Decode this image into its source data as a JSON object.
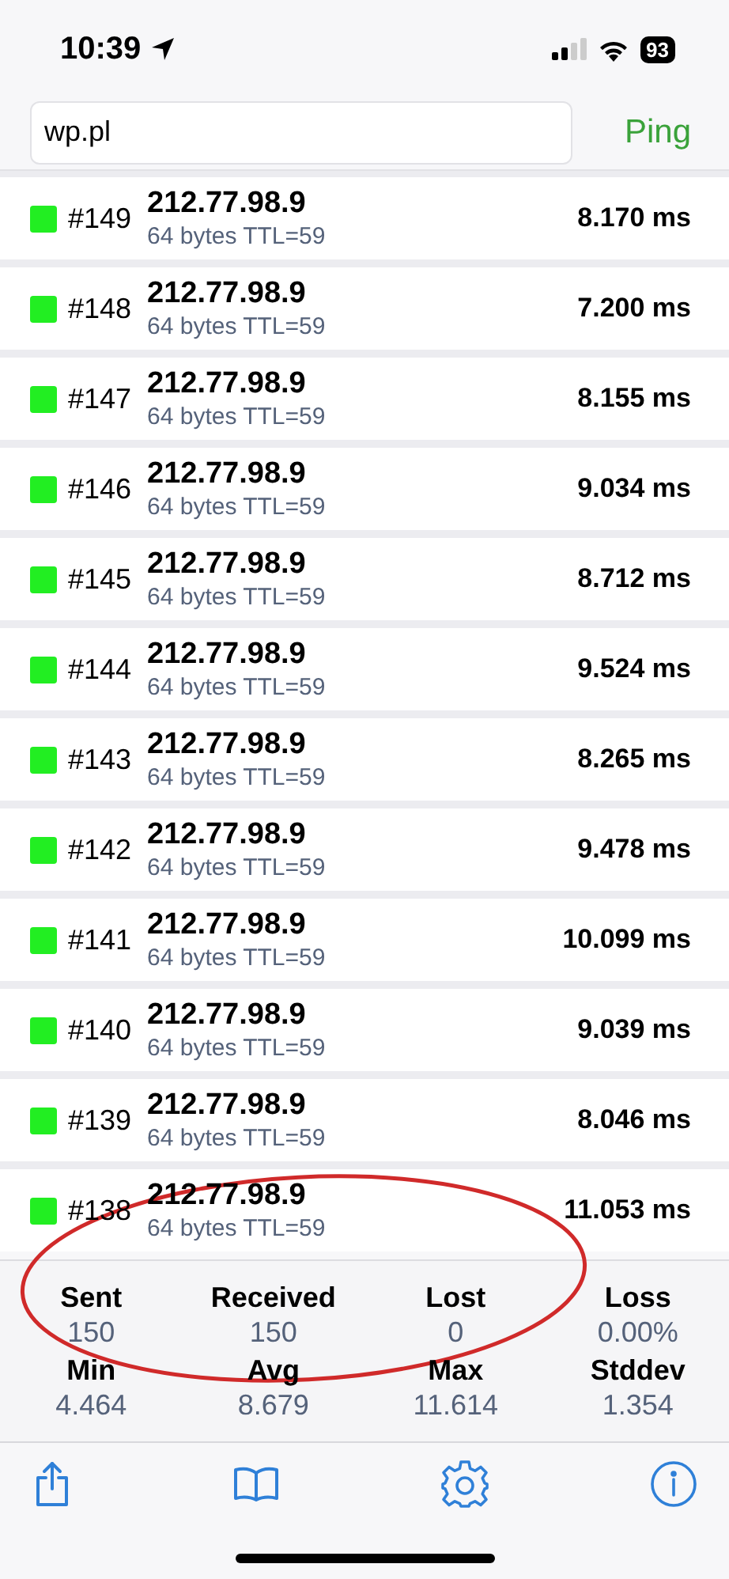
{
  "status_bar": {
    "time": "10:39",
    "battery": "93"
  },
  "host_field": {
    "value": "wp.pl"
  },
  "ping_button": {
    "label": "Ping"
  },
  "replies": [
    {
      "seq": "#149",
      "ip": "212.77.98.9",
      "detail": "64 bytes TTL=59",
      "time": "8.170 ms",
      "color": "#22ee22"
    },
    {
      "seq": "#148",
      "ip": "212.77.98.9",
      "detail": "64 bytes TTL=59",
      "time": "7.200 ms",
      "color": "#22ee22"
    },
    {
      "seq": "#147",
      "ip": "212.77.98.9",
      "detail": "64 bytes TTL=59",
      "time": "8.155 ms",
      "color": "#22ee22"
    },
    {
      "seq": "#146",
      "ip": "212.77.98.9",
      "detail": "64 bytes TTL=59",
      "time": "9.034 ms",
      "color": "#22ee22"
    },
    {
      "seq": "#145",
      "ip": "212.77.98.9",
      "detail": "64 bytes TTL=59",
      "time": "8.712 ms",
      "color": "#22ee22"
    },
    {
      "seq": "#144",
      "ip": "212.77.98.9",
      "detail": "64 bytes TTL=59",
      "time": "9.524 ms",
      "color": "#22ee22"
    },
    {
      "seq": "#143",
      "ip": "212.77.98.9",
      "detail": "64 bytes TTL=59",
      "time": "8.265 ms",
      "color": "#22ee22"
    },
    {
      "seq": "#142",
      "ip": "212.77.98.9",
      "detail": "64 bytes TTL=59",
      "time": "9.478 ms",
      "color": "#22ee22"
    },
    {
      "seq": "#141",
      "ip": "212.77.98.9",
      "detail": "64 bytes TTL=59",
      "time": "10.099 ms",
      "color": "#22ee22"
    },
    {
      "seq": "#140",
      "ip": "212.77.98.9",
      "detail": "64 bytes TTL=59",
      "time": "9.039 ms",
      "color": "#22ee22"
    },
    {
      "seq": "#139",
      "ip": "212.77.98.9",
      "detail": "64 bytes TTL=59",
      "time": "8.046 ms",
      "color": "#22ee22"
    },
    {
      "seq": "#138",
      "ip": "212.77.98.9",
      "detail": "64 bytes TTL=59",
      "time": "11.053 ms",
      "color": "#22ee22"
    }
  ],
  "stats": [
    {
      "label": "Sent",
      "value": "150"
    },
    {
      "label": "Received",
      "value": "150"
    },
    {
      "label": "Lost",
      "value": "0"
    },
    {
      "label": "Loss",
      "value": "0.00%"
    },
    {
      "label": "Min",
      "value": "4.464"
    },
    {
      "label": "Avg",
      "value": "8.679"
    },
    {
      "label": "Max",
      "value": "11.614"
    },
    {
      "label": "Stddev",
      "value": "1.354"
    }
  ],
  "toolbar": [
    {
      "kind": "share"
    },
    {
      "kind": "book"
    },
    {
      "kind": "settings"
    },
    {
      "kind": "info"
    }
  ],
  "red_circle_annotation": true
}
